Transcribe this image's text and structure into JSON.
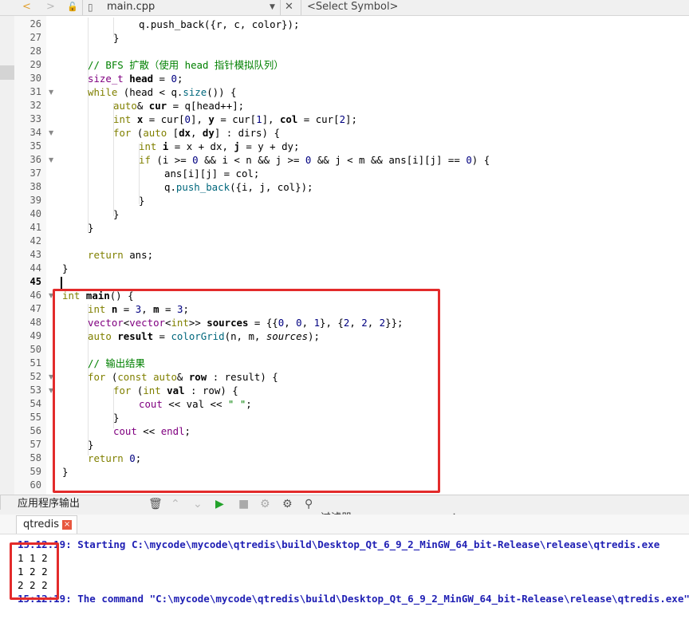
{
  "toolbar": {
    "back_icon": "<",
    "forward_icon": ">",
    "file_name": "main.cpp",
    "symbol_placeholder": "<Select Symbol>"
  },
  "code_lines": [
    {
      "n": "26",
      "indent": 3,
      "html": "q.push_back({r, c, color});"
    },
    {
      "n": "27",
      "indent": 2,
      "html": "}"
    },
    {
      "n": "28",
      "indent": 0,
      "html": ""
    },
    {
      "n": "29",
      "indent": 1,
      "html": "<span class='cm'>// BFS 扩散（使用 head 指针模拟队列）</span>"
    },
    {
      "n": "30",
      "indent": 1,
      "html": "<span class='ty'>size_t</span> <span class='bo'>head</span> = <span class='nm'>0</span>;"
    },
    {
      "n": "31",
      "indent": 1,
      "html": "<span class='kw'>while</span> (head < q.<span class='fn'>size</span>()) {",
      "fold": true
    },
    {
      "n": "32",
      "indent": 2,
      "html": "<span class='kw'>auto</span>& <span class='bo'>cur</span> = q[head++];"
    },
    {
      "n": "33",
      "indent": 2,
      "html": "<span class='kw'>int</span> <span class='bo'>x</span> = cur[<span class='nm'>0</span>], <span class='bo'>y</span> = cur[<span class='nm'>1</span>], <span class='bo'>col</span> = cur[<span class='nm'>2</span>];"
    },
    {
      "n": "34",
      "indent": 2,
      "html": "<span class='kw'>for</span> (<span class='kw'>auto</span> [<span class='bo'>dx</span>, <span class='bo'>dy</span>] : dirs) {",
      "fold": true
    },
    {
      "n": "35",
      "indent": 3,
      "html": "<span class='kw'>int</span> <span class='bo'>i</span> = x + dx, <span class='bo'>j</span> = y + dy;"
    },
    {
      "n": "36",
      "indent": 3,
      "html": "<span class='kw'>if</span> (i >= <span class='nm'>0</span> && i < n && j >= <span class='nm'>0</span> && j < m && ans[i][j] == <span class='nm'>0</span>) {",
      "fold": true
    },
    {
      "n": "37",
      "indent": 4,
      "html": "ans[i][j] = col;"
    },
    {
      "n": "38",
      "indent": 4,
      "html": "q.<span class='fn'>push_back</span>({i, j, col});"
    },
    {
      "n": "39",
      "indent": 3,
      "html": "}"
    },
    {
      "n": "40",
      "indent": 2,
      "html": "}"
    },
    {
      "n": "41",
      "indent": 1,
      "html": "}"
    },
    {
      "n": "42",
      "indent": 0,
      "html": ""
    },
    {
      "n": "43",
      "indent": 1,
      "html": "<span class='kw'>return</span> ans;"
    },
    {
      "n": "44",
      "indent": 0,
      "html": "}"
    },
    {
      "n": "45",
      "indent": 0,
      "html": "",
      "current": true
    },
    {
      "n": "46",
      "indent": 0,
      "html": "<span class='kw'>int</span> <span class='bo'>main</span>() {",
      "fold": true
    },
    {
      "n": "47",
      "indent": 1,
      "html": "<span class='kw'>int</span> <span class='bo'>n</span> = <span class='nm'>3</span>, <span class='bo'>m</span> = <span class='nm'>3</span>;"
    },
    {
      "n": "48",
      "indent": 1,
      "html": "<span class='ty'>vector</span><<span class='ty'>vector</span><<span class='kw'>int</span>>> <span class='bo'>sources</span> = {{<span class='nm'>0</span>, <span class='nm'>0</span>, <span class='nm'>1</span>}, {<span class='nm'>2</span>, <span class='nm'>2</span>, <span class='nm'>2</span>}};"
    },
    {
      "n": "49",
      "indent": 1,
      "html": "<span class='kw'>auto</span> <span class='bo'>result</span> = <span class='fn'>colorGrid</span>(n, m, <span class='it'>sources</span>);"
    },
    {
      "n": "50",
      "indent": 0,
      "html": ""
    },
    {
      "n": "51",
      "indent": 1,
      "html": "<span class='cm'>// 输出结果</span>"
    },
    {
      "n": "52",
      "indent": 1,
      "html": "<span class='kw'>for</span> (<span class='kw'>const auto</span>& <span class='bo'>row</span> : result) {",
      "fold": true
    },
    {
      "n": "53",
      "indent": 2,
      "html": "<span class='kw'>for</span> (<span class='kw'>int</span> <span class='bo'>val</span> : row) {",
      "fold": true
    },
    {
      "n": "54",
      "indent": 3,
      "html": "<span class='ty'>cout</span> << val << <span class='st'>\" \"</span>;"
    },
    {
      "n": "55",
      "indent": 2,
      "html": "}"
    },
    {
      "n": "56",
      "indent": 2,
      "html": "<span class='ty'>cout</span> << <span class='ty'>endl</span>;"
    },
    {
      "n": "57",
      "indent": 1,
      "html": "}"
    },
    {
      "n": "58",
      "indent": 1,
      "html": "<span class='kw'>return</span> <span class='nm'>0</span>;"
    },
    {
      "n": "59",
      "indent": 0,
      "html": "}"
    },
    {
      "n": "60",
      "indent": 0,
      "html": ""
    }
  ],
  "output_panel": {
    "title": "应用程序输出",
    "filter_label": "过滤器",
    "plus": "+",
    "minus": "−",
    "tab_label": "qtredis",
    "tab_close": "×",
    "start_line": "15:12:19: Starting C:\\mycode\\mycode\\qtredis\\build\\Desktop_Qt_6_9_2_MinGW_64_bit-Release\\release\\qtredis.exe",
    "result_rows": [
      "1 1 2",
      "1 2 2",
      "2 2 2"
    ],
    "end_line": "15:12:19: The command \"C:\\mycode\\mycode\\qtredis\\build\\Desktop_Qt_6_9_2_MinGW_64_bit-Release\\release\\qtredis.exe\""
  },
  "colors": {
    "highlight_box": "#e32b2b",
    "log_text": "#1f1fb4",
    "keyword": "#808000",
    "comment": "#008000",
    "number": "#000080"
  }
}
